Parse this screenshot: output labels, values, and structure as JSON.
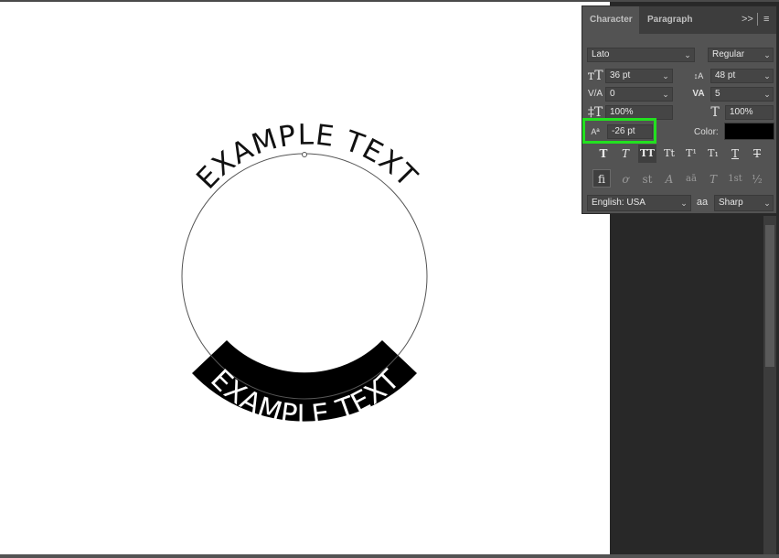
{
  "canvas": {
    "top_text": "EXAMPLE TEXT",
    "bottom_text": "EXAMPLE TEXT"
  },
  "panel": {
    "tabs": {
      "character": "Character",
      "paragraph": "Paragraph"
    },
    "controls": {
      "collapse": ">>",
      "menu": "≡"
    },
    "font_family": "Lato",
    "font_style": "Regular",
    "font_size": "36 pt",
    "leading": "48 pt",
    "kerning": "0",
    "tracking": "5",
    "vertical_scale": "100%",
    "horizontal_scale": "100%",
    "baseline_shift": "-26 pt",
    "color_label": "Color:",
    "color_value": "#000000",
    "language": "English: USA",
    "aa_icon_text": "aa",
    "antialias": "Sharp",
    "style_buttons": [
      "T",
      "T",
      "TT",
      "Tt",
      "T¹",
      "T₁",
      "T",
      "T"
    ],
    "opentype_buttons": [
      "fi",
      "ơ",
      "st",
      "A",
      "aā",
      "T",
      "1st",
      "½"
    ]
  }
}
